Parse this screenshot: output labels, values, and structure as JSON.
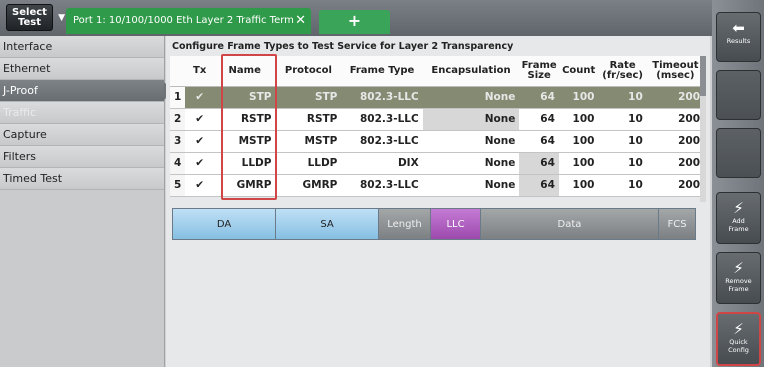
{
  "header": {
    "select_test": "Select\nTest",
    "tab_title": "Port 1: 10/100/1000 Eth Layer 2 Traffic Term",
    "add_tab": "+"
  },
  "sidebar": {
    "items": [
      {
        "label": "Interface"
      },
      {
        "label": "Ethernet"
      },
      {
        "label": "J-Proof"
      },
      {
        "label": "Traffic"
      },
      {
        "label": "Capture"
      },
      {
        "label": "Filters"
      },
      {
        "label": "Timed Test"
      }
    ]
  },
  "main": {
    "title": "Configure Frame Types to Test Service for Layer 2 Transparency",
    "columns": [
      "",
      "Tx",
      "Name",
      "Protocol",
      "Frame Type",
      "Encapsulation",
      "Frame Size",
      "Count",
      "Rate (fr/sec)",
      "Timeout (msec)"
    ],
    "rows": [
      {
        "num": "1",
        "tx": "✔",
        "name": "STP",
        "protocol": "STP",
        "frame_type": "802.3-LLC",
        "encapsulation": "None",
        "frame_size": "64",
        "count": "100",
        "rate": "10",
        "timeout": "200"
      },
      {
        "num": "2",
        "tx": "✔",
        "name": "RSTP",
        "protocol": "RSTP",
        "frame_type": "802.3-LLC",
        "encapsulation": "None",
        "frame_size": "64",
        "count": "100",
        "rate": "10",
        "timeout": "200"
      },
      {
        "num": "3",
        "tx": "✔",
        "name": "MSTP",
        "protocol": "MSTP",
        "frame_type": "802.3-LLC",
        "encapsulation": "None",
        "frame_size": "64",
        "count": "100",
        "rate": "10",
        "timeout": "200"
      },
      {
        "num": "4",
        "tx": "✔",
        "name": "LLDP",
        "protocol": "LLDP",
        "frame_type": "DIX",
        "encapsulation": "None",
        "frame_size": "64",
        "count": "100",
        "rate": "10",
        "timeout": "200"
      },
      {
        "num": "5",
        "tx": "✔",
        "name": "GMRP",
        "protocol": "GMRP",
        "frame_type": "802.3-LLC",
        "encapsulation": "None",
        "frame_size": "64",
        "count": "100",
        "rate": "10",
        "timeout": "200"
      }
    ],
    "frame_segments": [
      "DA",
      "SA",
      "Length",
      "LLC",
      "Data",
      "FCS"
    ]
  },
  "rightbar": {
    "results": "Results",
    "add_frame": "Add\nFrame",
    "remove_frame": "Remove\nFrame",
    "quick_config": "Quick\nConfig"
  },
  "colors": {
    "tab_green": "#2f9a49",
    "highlight_red": "#d04545",
    "selected_row": "#858a72"
  },
  "icons": {
    "results": "arrow-left-icon",
    "actions": "lightning-icon"
  }
}
